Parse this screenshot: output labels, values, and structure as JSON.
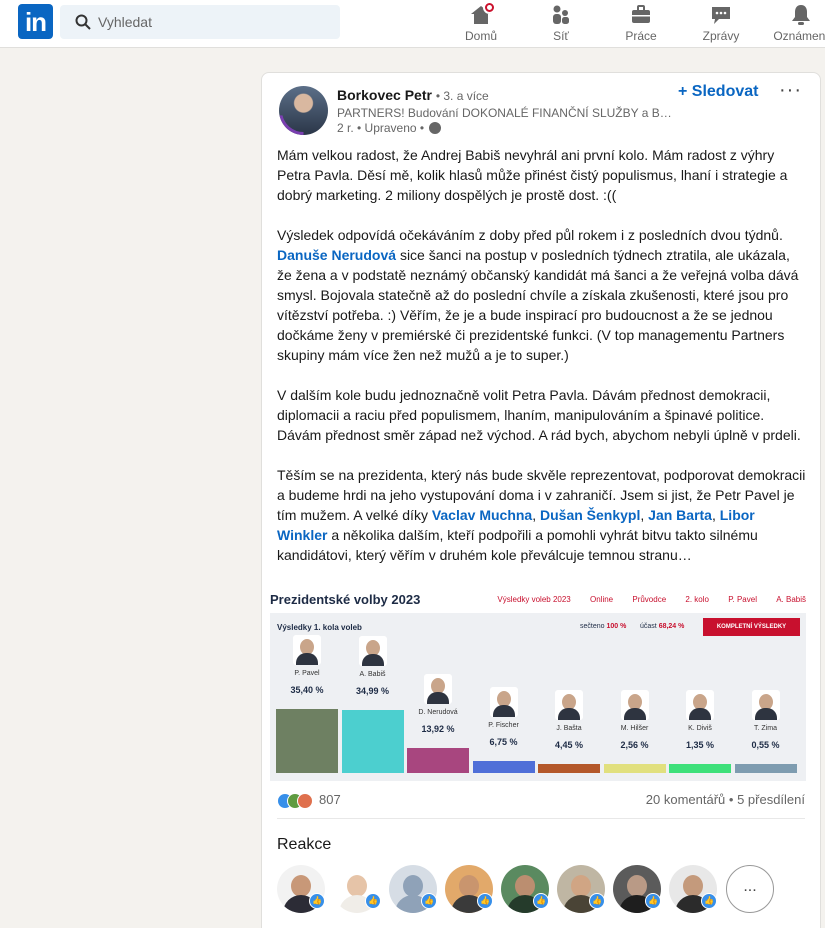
{
  "header": {
    "logo": "in",
    "search_placeholder": "Vyhledat",
    "nav": [
      {
        "label": "Domů",
        "icon": "home-icon"
      },
      {
        "label": "Síť",
        "icon": "network-icon"
      },
      {
        "label": "Práce",
        "icon": "briefcase-icon"
      },
      {
        "label": "Zprávy",
        "icon": "messages-icon"
      },
      {
        "label": "Oznámení",
        "icon": "bell-icon"
      }
    ]
  },
  "post": {
    "author": "Borkovec Petr",
    "degree": "• 3. a více",
    "headline": "PARTNERS! Budování DOKONALÉ FINANČNÍ SLUŽBY a BANKY...",
    "meta": "2 r. • Upraveno •",
    "follow_label": "+ Sledovat",
    "more_label": "···",
    "paragraphs": {
      "p1": "Mám velkou radost, že Andrej Babiš nevyhrál ani první kolo. Mám radost z výhry Petra Pavla. Děsí mě, kolik hlasů může přinést čistý populismus, lhaní i strategie a dobrý marketing. 2 miliony dospělých je prostě dost. :((",
      "p2a": "Výsledek odpovídá očekáváním z doby před půl rokem i z posledních dvou týdnů.",
      "p2_mention": "Danuše Nerudová",
      "p2b": "sice šanci na postup v posledních týdnech ztratila, ale ukázala, že žena a v podstatě neznámý občanský kandidát má šanci a že veřejná volba dává smysl. Bojovala statečně až do poslední chvíle a získala zkušenosti, které jsou pro vítězství potřeba. :) Věřím, že je a bude inspirací pro budoucnost a že se jednou dočkáme ženy v premiérské či prezidentské funkci. (V top managementu Partners skupiny mám více žen než mužů a je to super.)",
      "p3": "V dalším kole budu jednoznačně volit Petra Pavla. Dávám přednost demokracii, diplomacii a raciu před populismem, lhaním, manipulováním a špinavé politice. Dávám přednost směr západ než východ. A rád bych, abychom nebyli úplně v prdeli.",
      "p4a": "Těším se na prezidenta, který nás bude skvěle reprezentovat, podporovat demokracii a budeme hrdi na jeho vystupování doma i v zahraničí. Jsem si jist, že Petr Pavel je tím mužem. A velké díky",
      "m1": "Vaclav Muchna",
      "m2": "Dušan Šenkypl",
      "m3": "Jan Barta",
      "m4": "Libor Winkler",
      "p4b": "a několika dalším, kteří podpořili a pomohli vyhrát bitvu takto silnému kandidátovi, který věřím v druhém kole převálcuje temnou stranu…"
    }
  },
  "election_image": {
    "title": "Prezidentské volby 2023",
    "nav": [
      "Výsledky voleb 2023",
      "Online",
      "Průvodce",
      "2. kolo",
      "P. Pavel",
      "A. Babiš"
    ],
    "panel_title": "Výsledky 1. kola voleb",
    "secteno_label": "sečteno",
    "secteno_value": "100 %",
    "ucast_label": "účast",
    "ucast_value": "68,24 %",
    "button": "KOMPLETNÍ VÝSLEDKY",
    "candidates": [
      {
        "name": "P. Pavel",
        "pct": "35,40 %",
        "value": 35.4,
        "color": "#6e8062"
      },
      {
        "name": "A. Babiš",
        "pct": "34,99 %",
        "value": 34.99,
        "color": "#4ccfcf"
      },
      {
        "name": "D. Nerudová",
        "pct": "13,92 %",
        "value": 13.92,
        "color": "#a8467f"
      },
      {
        "name": "P. Fischer",
        "pct": "6,75 %",
        "value": 6.75,
        "color": "#4f6fd8"
      },
      {
        "name": "J. Bašta",
        "pct": "4,45 %",
        "value": 4.45,
        "color": "#b4582a"
      },
      {
        "name": "M. Hilšer",
        "pct": "2,56 %",
        "value": 2.56,
        "color": "#e1e07e"
      },
      {
        "name": "K. Diviš",
        "pct": "1,35 %",
        "value": 1.35,
        "color": "#3ee07a"
      },
      {
        "name": "T. Zima",
        "pct": "0,55 %",
        "value": 0.55,
        "color": "#7e9cb0"
      }
    ]
  },
  "social": {
    "reactions_count": "807",
    "comments": "20 komentářů • 5 přesdílení"
  },
  "reactions_section": {
    "title": "Reakce",
    "more_label": "..."
  },
  "colors": {
    "brand": "#0a66c2",
    "background": "#f4f2ee",
    "notification": "#cb112d"
  }
}
